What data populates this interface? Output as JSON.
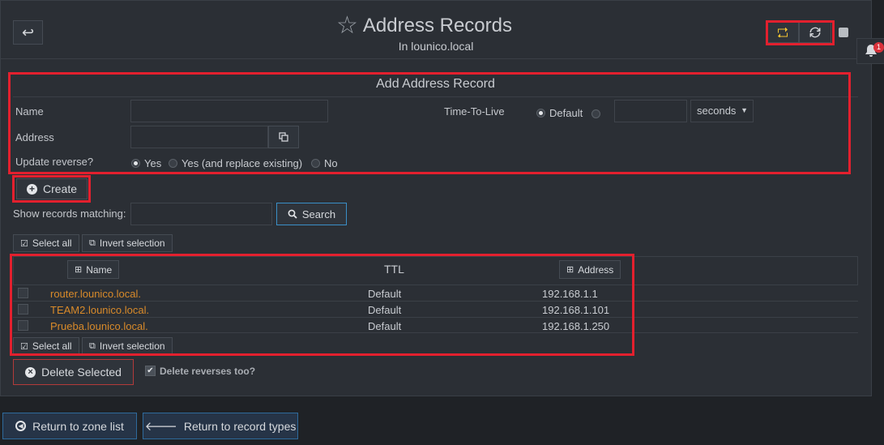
{
  "header": {
    "title": "Address Records",
    "subtitle": "In lounico.local",
    "back_icon": "↩",
    "star_icon": "☆",
    "notification_count": "1"
  },
  "form": {
    "title": "Add Address Record",
    "name_label": "Name",
    "address_label": "Address",
    "update_reverse_label": "Update reverse?",
    "ttl_label": "Time-To-Live",
    "ttl_default": "Default",
    "ttl_unit": "seconds",
    "reverse_options": [
      "Yes",
      "Yes (and replace existing)",
      "No"
    ]
  },
  "create_label": "Create",
  "search": {
    "label": "Show records matching:",
    "button": "Search"
  },
  "selection": {
    "select_all": "Select all",
    "invert": "Invert selection"
  },
  "table": {
    "col_name": "Name",
    "col_ttl": "TTL",
    "col_address": "Address",
    "rows": [
      {
        "name": "router.lounico.local.",
        "ttl": "Default",
        "address": "192.168.1.1"
      },
      {
        "name": "TEAM2.lounico.local.",
        "ttl": "Default",
        "address": "192.168.1.101"
      },
      {
        "name": "Prueba.lounico.local.",
        "ttl": "Default",
        "address": "192.168.1.250"
      }
    ]
  },
  "delete": {
    "button": "Delete Selected",
    "reverses": "Delete reverses too?"
  },
  "footer": {
    "zone_list": "Return to zone list",
    "record_types": "Return to record types"
  },
  "colors": {
    "accent_red": "#e3202e",
    "link_orange": "#d88a2a",
    "search_border": "#3a8fc7"
  }
}
